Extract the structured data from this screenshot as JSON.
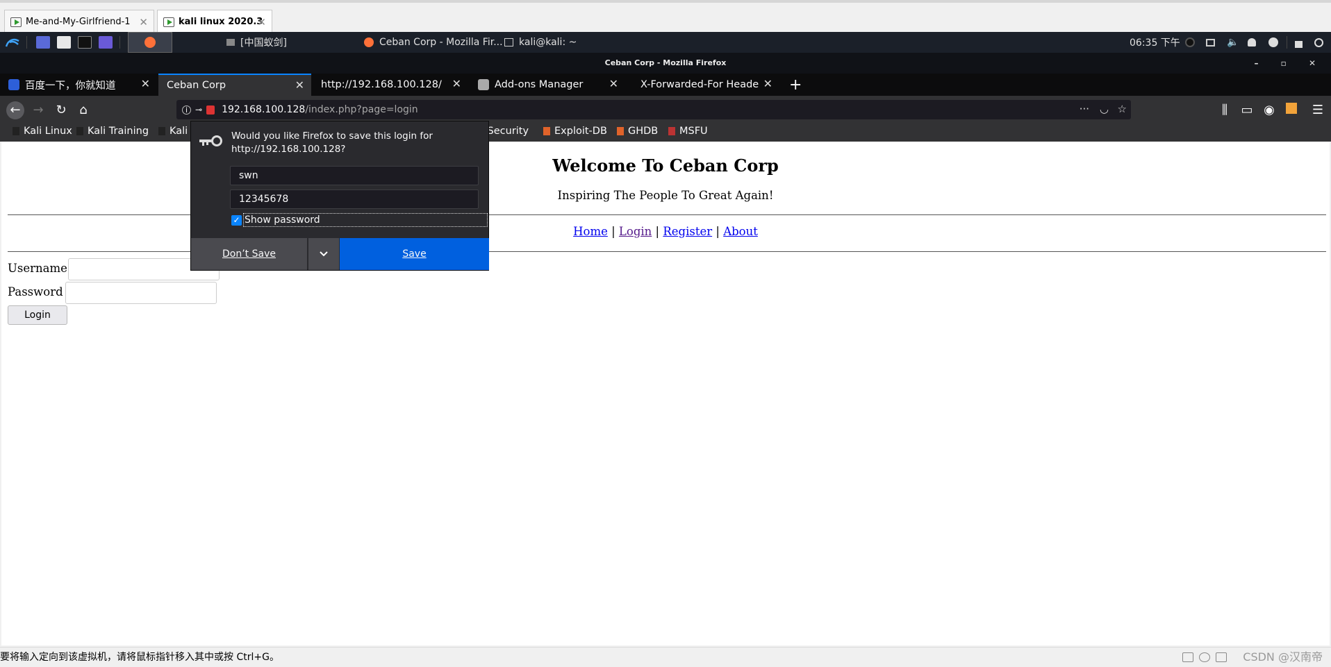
{
  "host": {
    "tabs": [
      {
        "label": "Me-and-My-Girlfriend-1"
      },
      {
        "label": "kali linux 2020.3"
      }
    ],
    "close_glyph": "✕"
  },
  "kali_panel": {
    "task_antsword": "[中国蚁剑]",
    "task_firefox": "Ceban Corp - Mozilla Fir...",
    "task_terminal": "kali@kali: ~",
    "clock": "06:35 下午"
  },
  "firefox": {
    "window_title": "Ceban Corp - Mozilla Firefox",
    "tabs": [
      {
        "label": "百度一下，你就知道"
      },
      {
        "label": "Ceban Corp"
      },
      {
        "label": "http://192.168.100.128/"
      },
      {
        "label": "Add-ons Manager"
      },
      {
        "label": "X-Forwarded-For Heade"
      }
    ],
    "new_tab": "+",
    "url_host": "192.168.100.128",
    "url_path": "/index.php?page=login",
    "bookmarks": [
      {
        "label": "Kali Linux"
      },
      {
        "label": "Kali Training"
      },
      {
        "label": "Kali"
      },
      {
        "label": "e Security"
      },
      {
        "label": "Exploit-DB"
      },
      {
        "label": "GHDB"
      },
      {
        "label": "MSFU"
      }
    ]
  },
  "page": {
    "title": "Welcome To Ceban Corp",
    "subtitle": "Inspiring The People To Great Again!",
    "nav": {
      "home": "Home",
      "login": "Login",
      "register": "Register",
      "about": "About",
      "sep": "|"
    },
    "username_label": "Username",
    "password_label": "Password",
    "login_button": "Login"
  },
  "doorhanger": {
    "message": "Would you like Firefox to save this login for http://192.168.100.128?",
    "username": "swn",
    "password": "12345678",
    "show_password": "Show password",
    "dont_save": "Don’t Save",
    "save": "Save",
    "checked": "✓"
  },
  "statusbar": {
    "message": "要将输入定向到该虚拟机，请将鼠标指针移入其中或按 Ctrl+G。",
    "watermark": "CSDN @汉南帝"
  },
  "colors": {
    "accent": "#0a84ff",
    "save_button": "#0060df",
    "link": "#0000ee",
    "visited": "#551a8b"
  }
}
